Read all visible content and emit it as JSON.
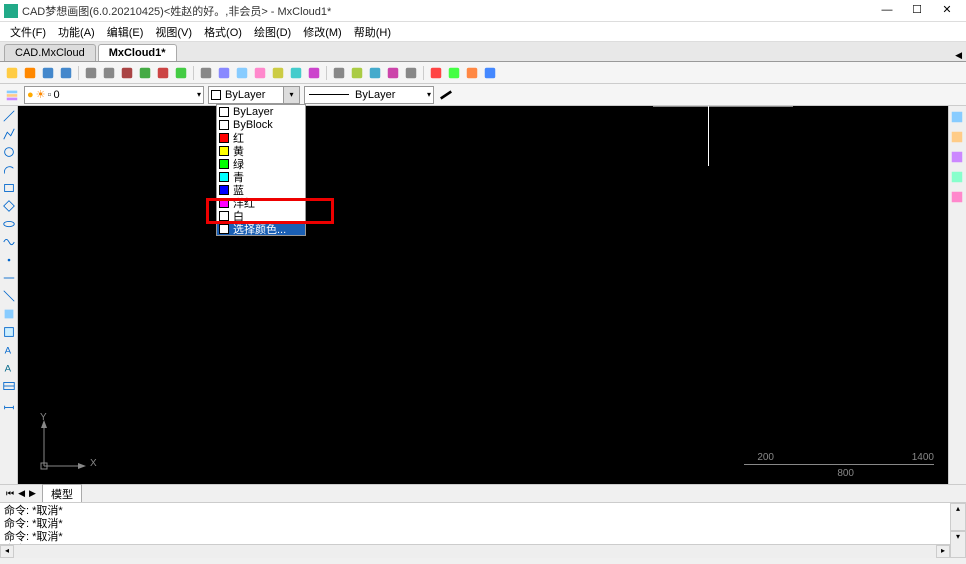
{
  "title": "CAD梦想画图(6.0.20210425)<姓赵的好。,非会员> - MxCloud1*",
  "menus": [
    "文件(F)",
    "功能(A)",
    "编辑(E)",
    "视图(V)",
    "格式(O)",
    "绘图(D)",
    "修改(M)",
    "帮助(H)"
  ],
  "tabs": [
    {
      "label": "CAD.MxCloud",
      "active": false
    },
    {
      "label": "MxCloud1*",
      "active": true
    }
  ],
  "layer_combo": {
    "value": "0"
  },
  "color_combo": {
    "label": "ByLayer"
  },
  "linetype_combo": {
    "label": "ByLayer"
  },
  "color_items": [
    {
      "label": "ByLayer",
      "color": "#fff"
    },
    {
      "label": "ByBlock",
      "color": "#fff"
    },
    {
      "label": "红",
      "color": "#f00"
    },
    {
      "label": "黄",
      "color": "#ff0"
    },
    {
      "label": "绿",
      "color": "#0f0"
    },
    {
      "label": "青",
      "color": "#0ff"
    },
    {
      "label": "蓝",
      "color": "#00f"
    },
    {
      "label": "洋红",
      "color": "#f0f"
    },
    {
      "label": "白",
      "color": "#fff"
    },
    {
      "label": "选择颜色...",
      "color": "#fff",
      "selected": true
    }
  ],
  "ruler": {
    "v1": "200",
    "v2": "800",
    "v3": "1400"
  },
  "ucs": {
    "y": "Y",
    "x": "X"
  },
  "bottom_tab": "模型",
  "cmd_prompt": "命令:",
  "cmd_history": [
    "命令: *取消*",
    "命令: *取消*",
    "命令: *取消*"
  ],
  "toolbar1_icons": [
    "new",
    "open",
    "save",
    "saveas",
    "prev",
    "next",
    "cut",
    "copy",
    "undo",
    "redo",
    "zoom-ext",
    "zoom-win",
    "pan",
    "orbit",
    "layer",
    "color",
    "line",
    "match",
    "hatch",
    "dim",
    "text",
    "block",
    "plot",
    "raster",
    "pdf",
    "web"
  ],
  "left_icons": [
    "line",
    "pline",
    "circle",
    "arc",
    "rect",
    "polygon",
    "ellipse",
    "spline",
    "point",
    "ray",
    "xline",
    "hatch",
    "region",
    "mtext",
    "text",
    "table",
    "dim"
  ],
  "right_icons": [
    "r1",
    "r2",
    "r3",
    "r4",
    "r5"
  ]
}
